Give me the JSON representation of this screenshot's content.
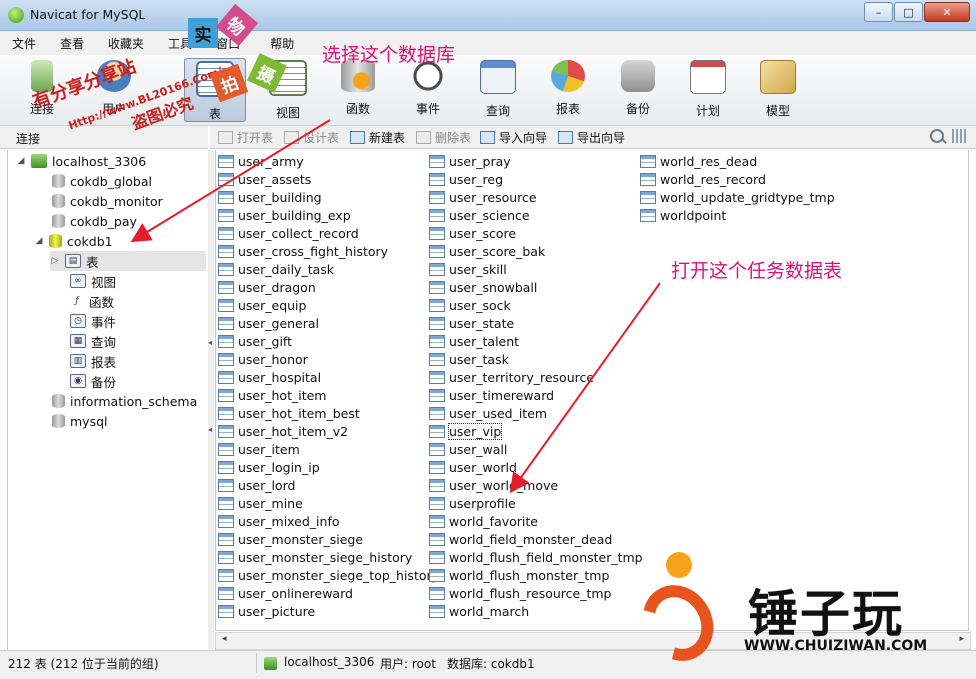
{
  "window": {
    "title": "Navicat for MySQL",
    "minimize": "–",
    "maximize": "□",
    "close": "✕"
  },
  "menu": [
    "文件",
    "查看",
    "收藏夹",
    "工具",
    "窗口",
    "帮助"
  ],
  "toolbar": {
    "buttons": [
      {
        "label": "连接",
        "icon": "connection-icon"
      },
      {
        "label": "用户",
        "icon": "user-icon"
      },
      {
        "label": "表",
        "icon": "table-icon"
      },
      {
        "label": "视图",
        "icon": "view-icon"
      },
      {
        "label": "函数",
        "icon": "function-icon"
      },
      {
        "label": "事件",
        "icon": "event-icon"
      },
      {
        "label": "查询",
        "icon": "query-icon"
      },
      {
        "label": "报表",
        "icon": "report-icon"
      },
      {
        "label": "备份",
        "icon": "backup-icon"
      },
      {
        "label": "计划",
        "icon": "schedule-icon"
      },
      {
        "label": "模型",
        "icon": "model-icon"
      }
    ],
    "active": "表"
  },
  "connection_panel": {
    "header": "连接"
  },
  "object_toolbar": {
    "open_table": "打开表",
    "design_table": "设计表",
    "new_table": "新建表",
    "delete_table": "删除表",
    "import_wizard": "导入向导",
    "export_wizard": "导出向导"
  },
  "tree": {
    "connection": "localhost_3306",
    "databases": [
      "cokdb_global",
      "cokdb_monitor",
      "cokdb_pay",
      "cokdb1",
      "information_schema",
      "mysql"
    ],
    "open_db_children": [
      "表",
      "视图",
      "函数",
      "事件",
      "查询",
      "报表",
      "备份"
    ]
  },
  "tables": {
    "col1": [
      "user_army",
      "user_assets",
      "user_building",
      "user_building_exp",
      "user_collect_record",
      "user_cross_fight_history",
      "user_daily_task",
      "user_dragon",
      "user_equip",
      "user_general",
      "user_gift",
      "user_honor",
      "user_hospital",
      "user_hot_item",
      "user_hot_item_best",
      "user_hot_item_v2",
      "user_item",
      "user_login_ip",
      "user_lord",
      "user_mine",
      "user_mixed_info",
      "user_monster_siege",
      "user_monster_siege_history",
      "user_monster_siege_top_history",
      "user_onlinereward",
      "user_picture"
    ],
    "col2": [
      "user_pray",
      "user_reg",
      "user_resource",
      "user_science",
      "user_score",
      "user_score_bak",
      "user_skill",
      "user_snowball",
      "user_sock",
      "user_state",
      "user_talent",
      "user_task",
      "user_territory_resource",
      "user_timereward",
      "user_used_item",
      "user_vip",
      "user_wall",
      "user_world",
      "user_world_move",
      "userprofile",
      "world_favorite",
      "world_field_monster_dead",
      "world_flush_field_monster_tmp",
      "world_flush_monster_tmp",
      "world_flush_resource_tmp",
      "world_march"
    ],
    "col3": [
      "world_res_dead",
      "world_res_record",
      "world_update_gridtype_tmp",
      "worldpoint"
    ],
    "focused": "user_vip"
  },
  "status": {
    "count": "212 表 (212 位于当前的组)",
    "connection": "localhost_3306",
    "user": "用户: root",
    "database": "数据库: cokdb1"
  },
  "annotations": {
    "select_db": "选择这个数据库",
    "open_table": "打开这个任务数据表",
    "watermark_1": "有分享分享站",
    "watermark_url": "Http://www.BL20166.Com/",
    "watermark_2": "盗图必究",
    "stamps": [
      "实",
      "物",
      "拍",
      "摄"
    ],
    "brand": "锤子玩",
    "brand_url": "WWW.CHUIZIWAN.COM",
    "color": "#e0107a"
  }
}
